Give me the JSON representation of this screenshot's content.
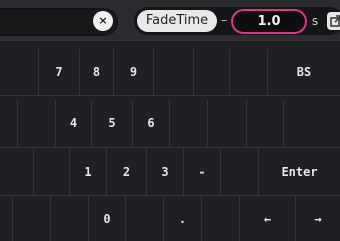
{
  "topbar": {
    "clear_icon": "×",
    "fade_label": "FadeTime",
    "dash": "–",
    "value": "1.0",
    "unit": "s",
    "accent_color": "#e0338a"
  },
  "keypad": {
    "rows": [
      [
        "",
        "7",
        "8",
        "9",
        "",
        "",
        "",
        "BS"
      ],
      [
        "",
        "4",
        "5",
        "6",
        "",
        "",
        "",
        ""
      ],
      [
        "",
        "1",
        "2",
        "3",
        "-",
        "",
        "Enter",
        ""
      ],
      [
        "",
        "0",
        "",
        ".",
        "",
        "←",
        "→",
        ""
      ]
    ]
  }
}
